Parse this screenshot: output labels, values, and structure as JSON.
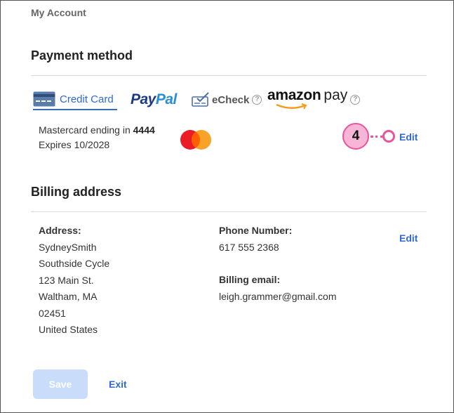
{
  "breadcrumb": "My Account",
  "payment": {
    "title": "Payment method",
    "tabs": {
      "credit_card": "Credit Card",
      "paypal_pay": "Pay",
      "paypal_pal": "Pal",
      "echeck": "eCheck",
      "amazon": "amazon",
      "amazon_pay": "pay",
      "help": "?"
    },
    "card_line_prefix": "Mastercard ending in ",
    "card_last4": "4444",
    "expires": "Expires 10/2028",
    "edit": "Edit",
    "callout": "4"
  },
  "billing": {
    "title": "Billing address",
    "address_label": "Address:",
    "address_lines": [
      "SydneySmith",
      "Southside Cycle",
      "123 Main St.",
      "Waltham, MA",
      "02451",
      "United States"
    ],
    "phone_label": "Phone Number:",
    "phone": "617 555 2368",
    "email_label": "Billing email:",
    "email": "leigh.grammer@gmail.com",
    "edit": "Edit"
  },
  "actions": {
    "save": "Save",
    "exit": "Exit"
  },
  "colors": {
    "accent": "#2d6ad6",
    "callout": "#e9549b",
    "paypal_dark": "#1b3a8c",
    "paypal_light": "#2a8fd8"
  }
}
